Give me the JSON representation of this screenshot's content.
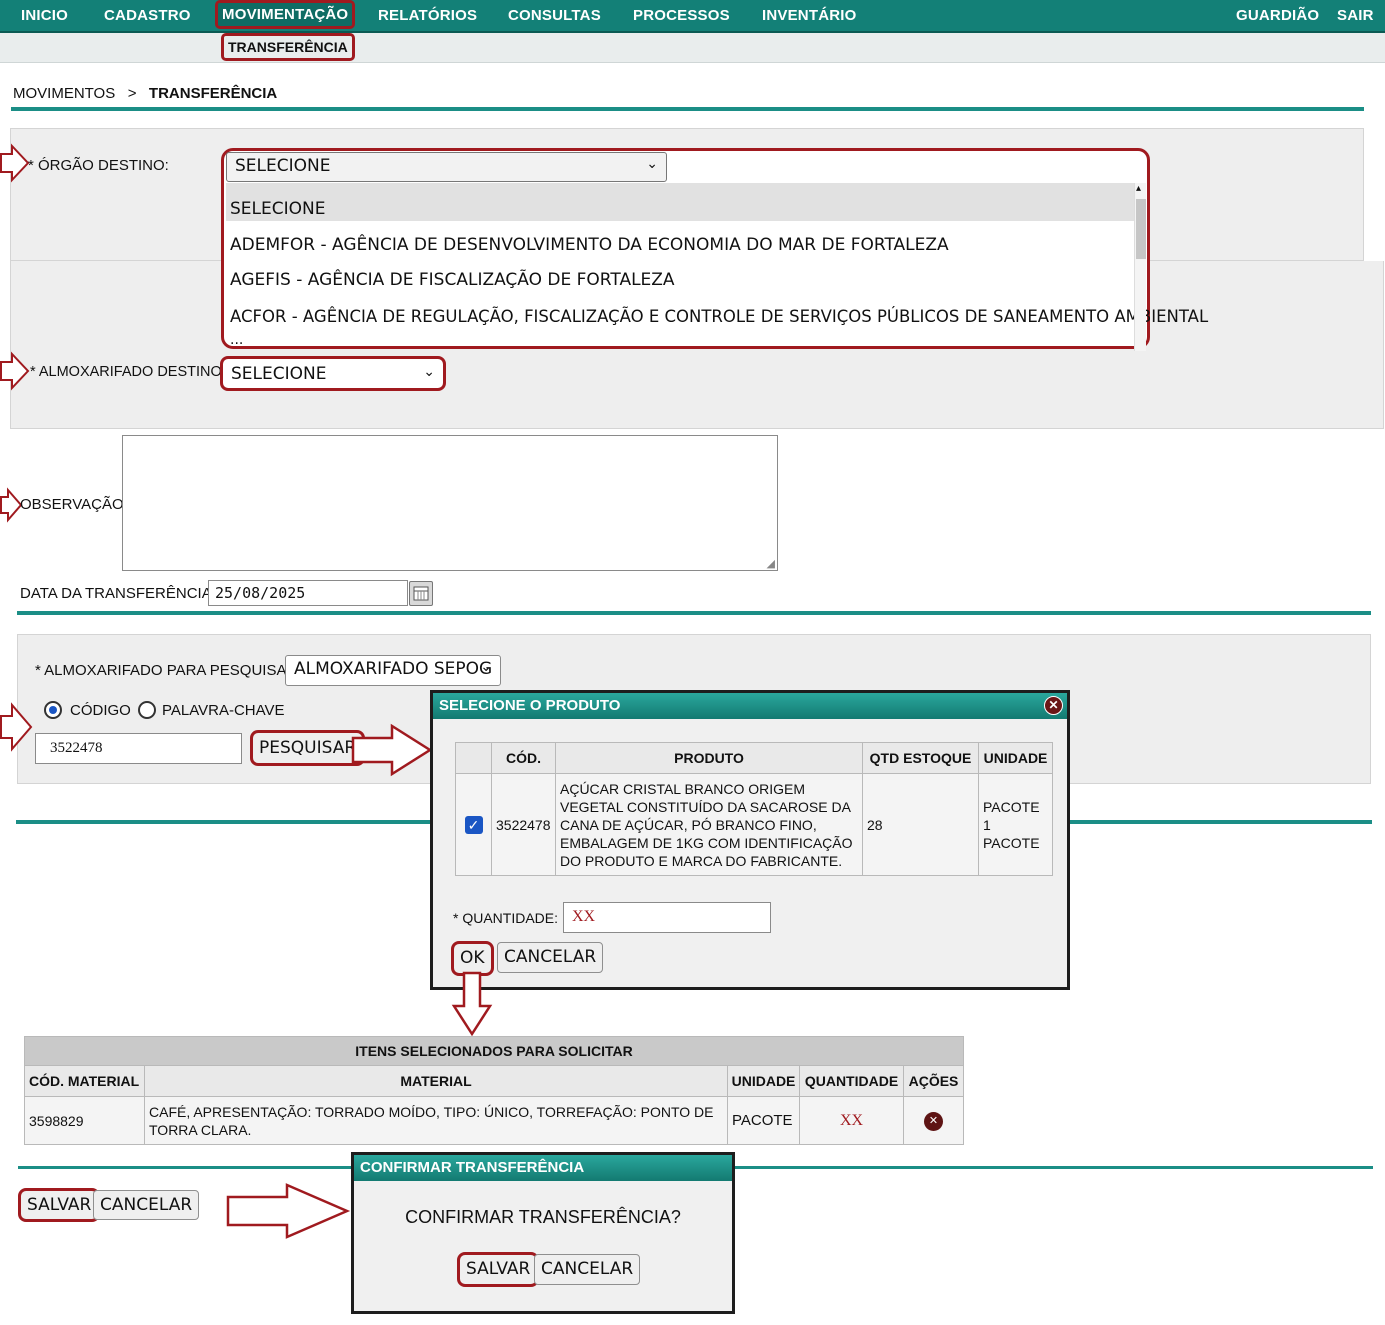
{
  "nav": {
    "items": [
      "INICIO",
      "CADASTRO",
      "MOVIMENTAÇÃO",
      "RELATÓRIOS",
      "CONSULTAS",
      "PROCESSOS",
      "INVENTÁRIO"
    ],
    "right": [
      "GUARDIÃO",
      "SAIR"
    ],
    "active_sub": "TRANSFERÊNCIA",
    "accent": "#138077",
    "highlight": "#a01a1f"
  },
  "breadcrumb": {
    "parent": "MOVIMENTOS",
    "sep": ">",
    "current": "TRANSFERÊNCIA"
  },
  "form": {
    "orgao_label": "* ÓRGÃO DESTINO:",
    "orgao_value": "SELECIONE",
    "orgao_options": [
      "SELECIONE",
      "ADEMFOR - AGÊNCIA DE DESENVOLVIMENTO DA ECONOMIA DO MAR DE FORTALEZA",
      "AGEFIS - AGÊNCIA DE FISCALIZAÇÃO DE FORTALEZA",
      "ACFOR - AGÊNCIA DE REGULAÇÃO, FISCALIZAÇÃO E CONTROLE DE SERVIÇOS PÚBLICOS DE SANEAMENTO AMBIENTAL",
      "..."
    ],
    "almox_label": "* ALMOXARIFADO DESTINO:",
    "almox_value": "SELECIONE",
    "obs_label": "OBSERVAÇÃO:",
    "date_label": "DATA DA TRANSFERÊNCIA:",
    "date_value": "25/08/2025"
  },
  "search": {
    "almox_label": "* ALMOXARIFADO PARA PESQUISA:",
    "almox_value": "ALMOXARIFADO SEPOG",
    "radio_codigo": "CÓDIGO",
    "radio_palavra": "PALAVRA-CHAVE",
    "code_value": "3522478",
    "button": "PESQUISAR"
  },
  "product_dialog": {
    "title": "SELECIONE O PRODUTO",
    "headers": [
      "CÓD.",
      "PRODUTO",
      "QTD ESTOQUE",
      "UNIDADE"
    ],
    "row": {
      "cod": "3522478",
      "produto": "AÇÚCAR CRISTAL BRANCO ORIGEM VEGETAL CONSTITUÍDO DA SACAROSE DA CANA DE AÇÚCAR, PÓ BRANCO FINO, EMBALAGEM DE 1KG COM IDENTIFICAÇÃO DO PRODUTO E MARCA DO FABRICANTE.",
      "qtd": "28",
      "unidade": "PACOTE 1 PACOTE"
    },
    "qty_label": "* QUANTIDADE:",
    "qty_value": "XX",
    "ok": "OK",
    "cancel": "CANCELAR"
  },
  "items": {
    "title": "ITENS SELECIONADOS PARA SOLICITAR",
    "headers": [
      "CÓD. MATERIAL",
      "MATERIAL",
      "UNIDADE",
      "QUANTIDADE",
      "AÇÕES"
    ],
    "row": {
      "cod": "3598829",
      "material": "CAFÉ, APRESENTAÇÃO: TORRADO MOÍDO, TIPO: ÚNICO, TORREFAÇÃO: PONTO DE TORRA CLARA.",
      "unidade": "PACOTE",
      "quantidade": "XX"
    }
  },
  "footer": {
    "save": "SALVAR",
    "cancel": "CANCELAR"
  },
  "confirm_dialog": {
    "title": "CONFIRMAR TRANSFERÊNCIA",
    "message": "CONFIRMAR TRANSFERÊNCIA?",
    "save": "SALVAR",
    "cancel": "CANCELAR"
  }
}
